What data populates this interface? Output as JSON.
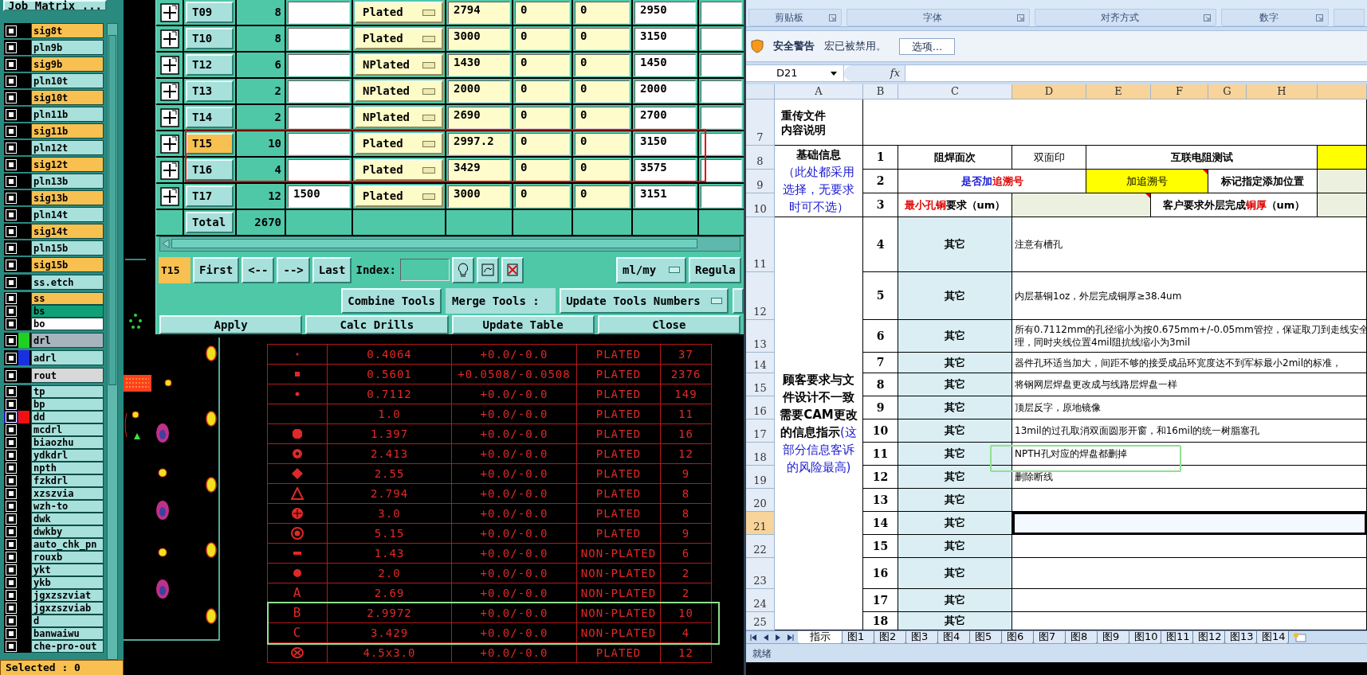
{
  "layer_panel": {
    "title": "Job Matrix ...",
    "groups": [
      {
        "layers": [
          {
            "name": "sig8t",
            "kind": "signal",
            "selected": false
          },
          {
            "name": "pln9b",
            "kind": "plane",
            "selected": false
          },
          {
            "name": "sig9b",
            "kind": "signal",
            "selected": false
          },
          {
            "name": "pln10t",
            "kind": "plane",
            "selected": false
          },
          {
            "name": "sig10t",
            "kind": "signal",
            "selected": false
          },
          {
            "name": "pln11b",
            "kind": "plane",
            "selected": false
          },
          {
            "name": "sig11b",
            "kind": "signal",
            "selected": false
          },
          {
            "name": "pln12t",
            "kind": "plane",
            "selected": false
          },
          {
            "name": "sig12t",
            "kind": "signal",
            "selected": false
          },
          {
            "name": "pln13b",
            "kind": "plane",
            "selected": false
          },
          {
            "name": "sig13b",
            "kind": "signal",
            "selected": false
          },
          {
            "name": "pln14t",
            "kind": "plane",
            "selected": false
          },
          {
            "name": "sig14t",
            "kind": "signal",
            "selected": false
          },
          {
            "name": "pln15b",
            "kind": "plane",
            "selected": false
          },
          {
            "name": "sig15b",
            "kind": "signal",
            "selected": false
          }
        ]
      },
      {
        "layers": [
          {
            "name": "ss.etch",
            "kind": "document",
            "selected": false
          }
        ]
      },
      {
        "layers": [
          {
            "name": "ss",
            "kind": "paste",
            "selected": false
          },
          {
            "name": "bs",
            "kind": "mask",
            "selected": false
          },
          {
            "name": "bo",
            "kind": "silk",
            "selected": false
          }
        ]
      },
      {
        "layers": [
          {
            "name": "drl",
            "kind": "drill",
            "color": "#20d020",
            "selected": false
          }
        ]
      },
      {
        "layers": [
          {
            "name": "adrl",
            "kind": "document",
            "color": "#1830e0",
            "selected": false
          }
        ]
      },
      {
        "layers": [
          {
            "name": "rout",
            "kind": "rout",
            "selected": false
          }
        ]
      },
      {
        "layers": [
          {
            "name": "tp",
            "kind": "document",
            "selected": false
          },
          {
            "name": "bp",
            "kind": "document",
            "selected": false
          },
          {
            "name": "dd",
            "kind": "document",
            "color": "#f01010",
            "selected": true
          },
          {
            "name": "mcdrl",
            "kind": "document",
            "selected": false
          },
          {
            "name": "biaozhu",
            "kind": "document",
            "selected": false
          },
          {
            "name": "ydkdrl",
            "kind": "document",
            "selected": false
          },
          {
            "name": "npth",
            "kind": "document",
            "selected": false
          },
          {
            "name": "fzkdrl",
            "kind": "document",
            "selected": false
          },
          {
            "name": "xzszvia",
            "kind": "document",
            "selected": false
          },
          {
            "name": "wzh-to",
            "kind": "document",
            "selected": false
          },
          {
            "name": "dwk",
            "kind": "document",
            "selected": false
          },
          {
            "name": "dwkby",
            "kind": "document",
            "selected": false
          },
          {
            "name": "auto_chk_pn",
            "kind": "document",
            "selected": false
          },
          {
            "name": "rouxb",
            "kind": "document",
            "selected": false
          },
          {
            "name": "ykt",
            "kind": "document",
            "selected": false
          },
          {
            "name": "ykb",
            "kind": "document",
            "selected": false
          },
          {
            "name": "jgxzszviat",
            "kind": "document",
            "selected": false
          },
          {
            "name": "jgxzszviab",
            "kind": "document",
            "selected": false
          },
          {
            "name": "d",
            "kind": "document",
            "selected": false
          },
          {
            "name": "banwaiwu",
            "kind": "document",
            "selected": false
          },
          {
            "name": "che-pro-out",
            "kind": "document",
            "selected": false
          }
        ]
      }
    ],
    "status": "Selected : 0"
  },
  "tool_table": {
    "rows": [
      {
        "tool": "T09",
        "count": "8",
        "type": "Plated",
        "column_5": "2794",
        "column_6": "0",
        "column_7": "0",
        "column_8": "2950",
        "selected": false,
        "boxed": false
      },
      {
        "tool": "T10",
        "count": "8",
        "type": "Plated",
        "column_5": "3000",
        "column_6": "0",
        "column_7": "0",
        "column_8": "3150",
        "selected": false,
        "boxed": false
      },
      {
        "tool": "T12",
        "count": "6",
        "type": "NPlated",
        "column_5": "1430",
        "column_6": "0",
        "column_7": "0",
        "column_8": "1450",
        "selected": false,
        "boxed": false
      },
      {
        "tool": "T13",
        "count": "2",
        "type": "NPlated",
        "column_5": "2000",
        "column_6": "0",
        "column_7": "0",
        "column_8": "2000",
        "selected": false,
        "boxed": false
      },
      {
        "tool": "T14",
        "count": "2",
        "type": "NPlated",
        "column_5": "2690",
        "column_6": "0",
        "column_7": "0",
        "column_8": "2700",
        "selected": false,
        "boxed": false
      },
      {
        "tool": "T15",
        "count": "10",
        "type": "Plated",
        "column_5": "2997.2",
        "column_6": "0",
        "column_7": "0",
        "column_8": "3150",
        "selected": true,
        "boxed": true
      },
      {
        "tool": "T16",
        "count": "4",
        "type": "Plated",
        "column_5": "3429",
        "column_6": "0",
        "column_7": "0",
        "column_8": "3575",
        "selected": false,
        "boxed": true
      },
      {
        "tool": "T17",
        "count": "12",
        "column_3": "1500",
        "type": "Plated",
        "column_5": "3000",
        "column_6": "0",
        "column_7": "0",
        "column_8": "3151",
        "selected": false,
        "boxed": false
      }
    ],
    "total": {
      "label": "Total",
      "count": "2670"
    }
  },
  "navigator": {
    "current": "T15",
    "buttons": [
      "First",
      "<--",
      "-->",
      "Last"
    ],
    "index_label": "Index:",
    "units": "ml/my",
    "mode": "Regula"
  },
  "merge_bar": {
    "combine": "Combine Tools",
    "merge_label": "Merge Tools :",
    "merge_option": "Update Tools Numbers"
  },
  "actions": [
    "Apply",
    "Calc Drills",
    "Update Table",
    "Close"
  ],
  "drill_legend": {
    "rows": [
      {
        "kind": "dot",
        "size": "0.4064",
        "tolerance": "+0.0/-0.0",
        "type": "PLATED",
        "count": "37",
        "boxed": false
      },
      {
        "kind": "square",
        "size": "0.5601",
        "tolerance": "+0.0508/-0.0508",
        "type": "PLATED",
        "count": "2376",
        "boxed": false
      },
      {
        "kind": "point",
        "size": "0.7112",
        "tolerance": "+0.0/-0.0",
        "type": "PLATED",
        "count": "149",
        "boxed": false
      },
      {
        "kind": "none",
        "size": "1.0",
        "tolerance": "+0.0/-0.0",
        "type": "PLATED",
        "count": "11",
        "boxed": false
      },
      {
        "kind": "octagon",
        "size": "1.397",
        "tolerance": "+0.0/-0.0",
        "type": "PLATED",
        "count": "16",
        "boxed": false
      },
      {
        "kind": "gear",
        "size": "2.413",
        "tolerance": "+0.0/-0.0",
        "type": "PLATED",
        "count": "12",
        "boxed": false
      },
      {
        "kind": "diamond",
        "size": "2.55",
        "tolerance": "+0.0/-0.0",
        "type": "PLATED",
        "count": "9",
        "boxed": false
      },
      {
        "kind": "triangle",
        "size": "2.794",
        "tolerance": "+0.0/-0.0",
        "type": "PLATED",
        "count": "8",
        "boxed": false
      },
      {
        "kind": "disc",
        "size": "3.0",
        "tolerance": "+0.0/-0.0",
        "type": "PLATED",
        "count": "8",
        "boxed": false
      },
      {
        "kind": "target",
        "size": "5.15",
        "tolerance": "+0.0/-0.0",
        "type": "PLATED",
        "count": "9",
        "boxed": false
      },
      {
        "kind": "bar",
        "size": "1.43",
        "tolerance": "+0.0/-0.0",
        "type": "NON-PLATED",
        "count": "6",
        "boxed": false
      },
      {
        "kind": "circle",
        "size": "2.0",
        "tolerance": "+0.0/-0.0",
        "type": "NON-PLATED",
        "count": "2",
        "boxed": false
      },
      {
        "kind": "letter",
        "symbol": "A",
        "size": "2.69",
        "tolerance": "+0.0/-0.0",
        "type": "NON-PLATED",
        "count": "2",
        "boxed": false
      },
      {
        "kind": "letter",
        "symbol": "B",
        "size": "2.9972",
        "tolerance": "+0.0/-0.0",
        "type": "NON-PLATED",
        "count": "10",
        "boxed": true
      },
      {
        "kind": "letter",
        "symbol": "C",
        "size": "3.429",
        "tolerance": "+0.0/-0.0",
        "type": "NON-PLATED",
        "count": "4",
        "boxed": true
      },
      {
        "kind": "ring",
        "size": "4.5x3.0",
        "tolerance": "+0.0/-0.0",
        "type": "PLATED",
        "count": "12",
        "boxed": false
      }
    ]
  },
  "spreadsheet": {
    "ribbon_groups": [
      "剪贴板",
      "字体",
      "对齐方式",
      "数字"
    ],
    "security_bar": {
      "title": "安全警告",
      "message": "宏已被禁用。",
      "button": "选项..."
    },
    "name_box": "D21",
    "function_label": "fx",
    "columns": [
      {
        "label": "A",
        "selected": false
      },
      {
        "label": "B",
        "selected": false
      },
      {
        "label": "C",
        "selected": false
      },
      {
        "label": "D",
        "selected": true
      },
      {
        "label": "E",
        "selected": true
      },
      {
        "label": "F",
        "selected": true
      },
      {
        "label": "G",
        "selected": true
      },
      {
        "label": "H",
        "selected": true
      },
      {
        "selected": true
      }
    ],
    "row_headers": [
      {
        "label": "7",
        "selected": false
      },
      {
        "label": "8",
        "selected": false
      },
      {
        "label": "9",
        "selected": false
      },
      {
        "label": "10",
        "selected": false
      },
      {
        "label": "11",
        "selected": false
      },
      {
        "label": "12",
        "selected": false
      },
      {
        "label": "13",
        "selected": false
      },
      {
        "label": "14",
        "selected": false
      },
      {
        "label": "15",
        "selected": false
      },
      {
        "label": "16",
        "selected": false
      },
      {
        "label": "17",
        "selected": false
      },
      {
        "label": "18",
        "selected": false
      },
      {
        "label": "19",
        "selected": false
      },
      {
        "label": "20",
        "selected": false
      },
      {
        "label": "21",
        "selected": true
      },
      {
        "label": "22",
        "selected": false
      },
      {
        "label": "23",
        "selected": false
      },
      {
        "label": "24",
        "selected": false
      },
      {
        "label": "25",
        "selected": false
      }
    ],
    "reupload_title": [
      "重传文件",
      "内容说明"
    ],
    "basic_info": {
      "title": "基础信息",
      "note": "（此处都采用选择，无要求时可不选）"
    },
    "basic_rows": [
      {
        "number": "1",
        "cells": [
          {
            "bold": true,
            "parts": [
              {
                "text": "阻焊面次"
              }
            ]
          },
          {
            "bold": false,
            "parts": [
              {
                "text": "双面印"
              }
            ]
          },
          {
            "bold": true,
            "parts": [
              {
                "text": "互联电阻测试"
              }
            ]
          },
          {
            "color": "#ffff00"
          }
        ]
      },
      {
        "number": "2",
        "cells": [
          {
            "bold": true,
            "parts": [
              {
                "text": "是否加",
                "color": "#1818d0"
              },
              {
                "text": "追溯号",
                "color": "#e00000"
              }
            ]
          },
          {
            "bold": false,
            "color": "#ffff00",
            "comment": true,
            "parts": [
              {
                "text": "加追溯号"
              }
            ]
          },
          {
            "bold": true,
            "parts": [
              {
                "text": "标记指定添加位置"
              }
            ]
          },
          {
            "color": "#ebf1de"
          }
        ]
      },
      {
        "number": "3",
        "cells": [
          {
            "bold": true,
            "parts": [
              {
                "text": "最小孔铜",
                "color": "#e00000"
              },
              {
                "text": "要求（um）"
              }
            ]
          },
          {
            "color": "#ebf1de",
            "comment": true
          },
          {
            "bold": true,
            "parts": [
              {
                "text": "客户要求外层完成"
              },
              {
                "text": "铜厚",
                "color": "#e00000"
              },
              {
                "text": "（um）"
              }
            ]
          },
          {
            "color": "#ebf1de"
          }
        ]
      }
    ],
    "requirements": {
      "title": "顾客要求与文件设计不一致需要CAM更改的信息指示",
      "note": "(这部分信息客诉的风险最高)"
    },
    "items": [
      {
        "number": "4",
        "category": "其它",
        "lines": [
          "注意有槽孔"
        ],
        "selected": false,
        "boxed": false
      },
      {
        "number": "5",
        "category": "其它",
        "lines": [
          "内层基铜1oz，外层完成铜厚≥38.4um"
        ],
        "selected": false,
        "boxed": false
      },
      {
        "number": "6",
        "category": "其它",
        "lines": [
          "所有0.7112mm的孔径缩小为按0.675mm+/-0.05mm管控，保证取刀到走线安全",
          "理，同时夹线位置4mil阻抗线缩小为3mil"
        ],
        "selected": false,
        "boxed": false
      },
      {
        "number": "7",
        "category": "其它",
        "lines": [
          "器件孔环适当加大，间距不够的接受成品环宽度达不到军标最小2mil的标准，"
        ],
        "selected": false,
        "boxed": false
      },
      {
        "number": "8",
        "category": "其它",
        "lines": [
          "将钢网层焊盘更改成与线路层焊盘一样"
        ],
        "selected": false,
        "boxed": false
      },
      {
        "number": "9",
        "category": "其它",
        "lines": [
          "顶层反字，原地镜像"
        ],
        "selected": false,
        "boxed": false
      },
      {
        "number": "10",
        "category": "其它",
        "lines": [
          "13mil的过孔取消双面圆形开窗，和16mil的统一树脂塞孔"
        ],
        "selected": false,
        "boxed": false
      },
      {
        "number": "11",
        "category": "其它",
        "lines": [
          "NPTH孔对应的焊盘都删掉"
        ],
        "selected": false,
        "boxed": true
      },
      {
        "number": "12",
        "category": "其它",
        "lines": [
          "删除断线"
        ],
        "selected": false,
        "boxed": false
      },
      {
        "number": "13",
        "category": "其它",
        "selected": false,
        "boxed": false
      },
      {
        "number": "14",
        "category": "其它",
        "selected": true,
        "boxed": false
      },
      {
        "number": "15",
        "category": "其它",
        "selected": false,
        "boxed": false
      },
      {
        "number": "16",
        "category": "其它",
        "selected": false,
        "boxed": false
      },
      {
        "number": "17",
        "category": "其它",
        "selected": false,
        "boxed": false
      },
      {
        "number": "18",
        "category": "其它",
        "selected": false,
        "boxed": false
      }
    ],
    "sheet_tabs": [
      {
        "label": "指示",
        "selected": true
      },
      {
        "label": "图1",
        "selected": false
      },
      {
        "label": "图2",
        "selected": false
      },
      {
        "label": "图3",
        "selected": false
      },
      {
        "label": "图4",
        "selected": false
      },
      {
        "label": "图5",
        "selected": false
      },
      {
        "label": "图6",
        "selected": false
      },
      {
        "label": "图7",
        "selected": false
      },
      {
        "label": "图8",
        "selected": false
      },
      {
        "label": "图9",
        "selected": false
      },
      {
        "label": "图10",
        "selected": false
      },
      {
        "label": "图11",
        "selected": false
      },
      {
        "label": "图12",
        "selected": false
      },
      {
        "label": "图13",
        "selected": false
      },
      {
        "label": "图14",
        "selected": false
      }
    ],
    "status": "就绪"
  }
}
